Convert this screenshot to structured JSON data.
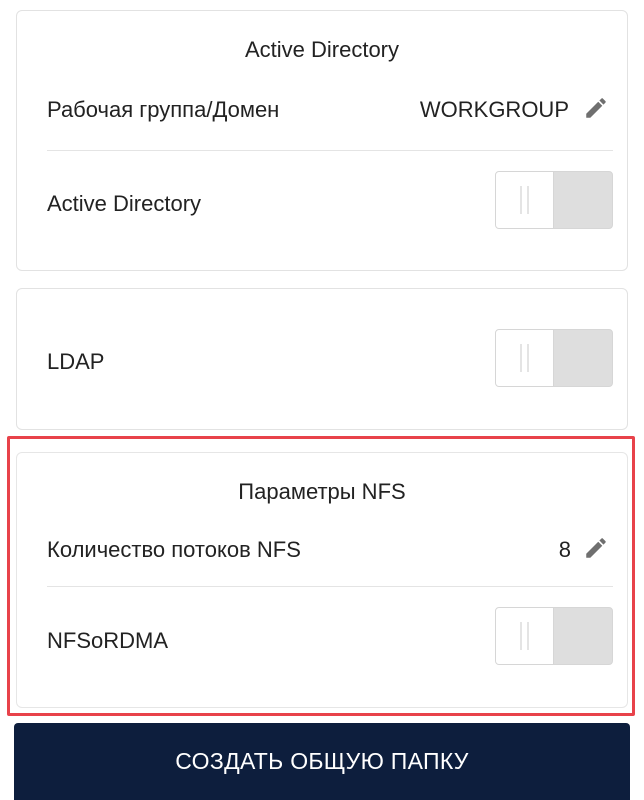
{
  "active_directory": {
    "title": "Active Directory",
    "workgroup_label": "Рабочая группа/Домен",
    "workgroup_value": "WORKGROUP",
    "edit_icon": "pencil-icon",
    "toggle_label": "Active Directory",
    "toggle_state": "off"
  },
  "ldap": {
    "toggle_label": "LDAP",
    "toggle_state": "off"
  },
  "nfs": {
    "title": "Параметры NFS",
    "threads_label": "Количество потоков NFS",
    "threads_value": "8",
    "edit_icon": "pencil-icon",
    "rdma_label": "NFSoRDMA",
    "rdma_state": "off"
  },
  "actions": {
    "create_label": "СОЗДАТЬ ОБЩУЮ ПАПКУ"
  },
  "colors": {
    "highlight": "#e8424a",
    "button_bg": "#0d1e3d",
    "toggle_off": "#dedede"
  }
}
